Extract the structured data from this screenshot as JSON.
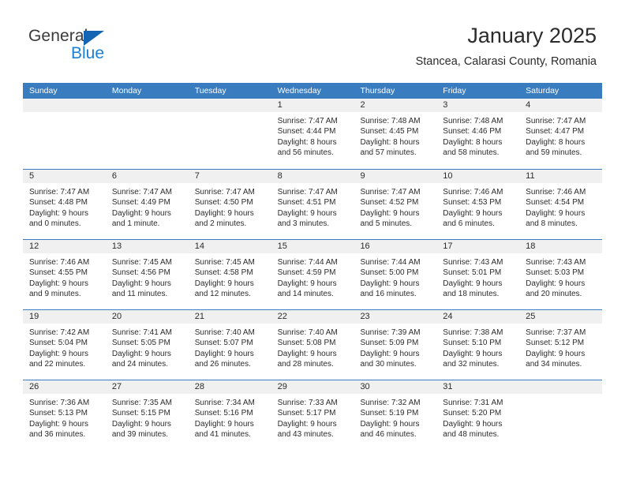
{
  "brand": {
    "name_part1": "General",
    "name_part2": "Blue",
    "accent_color": "#1b7fd4",
    "triangle_color": "#1565b5"
  },
  "header": {
    "title": "January 2025",
    "subtitle": "Stancea, Calarasi County, Romania"
  },
  "calendar": {
    "header_bg": "#3a7cc0",
    "daynum_bg": "#f0f0f0",
    "weekdays": [
      "Sunday",
      "Monday",
      "Tuesday",
      "Wednesday",
      "Thursday",
      "Friday",
      "Saturday"
    ],
    "weeks": [
      [
        {
          "day": "",
          "empty": true
        },
        {
          "day": "",
          "empty": true
        },
        {
          "day": "",
          "empty": true
        },
        {
          "day": "1",
          "sunrise": "Sunrise: 7:47 AM",
          "sunset": "Sunset: 4:44 PM",
          "daylight1": "Daylight: 8 hours",
          "daylight2": "and 56 minutes."
        },
        {
          "day": "2",
          "sunrise": "Sunrise: 7:48 AM",
          "sunset": "Sunset: 4:45 PM",
          "daylight1": "Daylight: 8 hours",
          "daylight2": "and 57 minutes."
        },
        {
          "day": "3",
          "sunrise": "Sunrise: 7:48 AM",
          "sunset": "Sunset: 4:46 PM",
          "daylight1": "Daylight: 8 hours",
          "daylight2": "and 58 minutes."
        },
        {
          "day": "4",
          "sunrise": "Sunrise: 7:47 AM",
          "sunset": "Sunset: 4:47 PM",
          "daylight1": "Daylight: 8 hours",
          "daylight2": "and 59 minutes."
        }
      ],
      [
        {
          "day": "5",
          "sunrise": "Sunrise: 7:47 AM",
          "sunset": "Sunset: 4:48 PM",
          "daylight1": "Daylight: 9 hours",
          "daylight2": "and 0 minutes."
        },
        {
          "day": "6",
          "sunrise": "Sunrise: 7:47 AM",
          "sunset": "Sunset: 4:49 PM",
          "daylight1": "Daylight: 9 hours",
          "daylight2": "and 1 minute."
        },
        {
          "day": "7",
          "sunrise": "Sunrise: 7:47 AM",
          "sunset": "Sunset: 4:50 PM",
          "daylight1": "Daylight: 9 hours",
          "daylight2": "and 2 minutes."
        },
        {
          "day": "8",
          "sunrise": "Sunrise: 7:47 AM",
          "sunset": "Sunset: 4:51 PM",
          "daylight1": "Daylight: 9 hours",
          "daylight2": "and 3 minutes."
        },
        {
          "day": "9",
          "sunrise": "Sunrise: 7:47 AM",
          "sunset": "Sunset: 4:52 PM",
          "daylight1": "Daylight: 9 hours",
          "daylight2": "and 5 minutes."
        },
        {
          "day": "10",
          "sunrise": "Sunrise: 7:46 AM",
          "sunset": "Sunset: 4:53 PM",
          "daylight1": "Daylight: 9 hours",
          "daylight2": "and 6 minutes."
        },
        {
          "day": "11",
          "sunrise": "Sunrise: 7:46 AM",
          "sunset": "Sunset: 4:54 PM",
          "daylight1": "Daylight: 9 hours",
          "daylight2": "and 8 minutes."
        }
      ],
      [
        {
          "day": "12",
          "sunrise": "Sunrise: 7:46 AM",
          "sunset": "Sunset: 4:55 PM",
          "daylight1": "Daylight: 9 hours",
          "daylight2": "and 9 minutes."
        },
        {
          "day": "13",
          "sunrise": "Sunrise: 7:45 AM",
          "sunset": "Sunset: 4:56 PM",
          "daylight1": "Daylight: 9 hours",
          "daylight2": "and 11 minutes."
        },
        {
          "day": "14",
          "sunrise": "Sunrise: 7:45 AM",
          "sunset": "Sunset: 4:58 PM",
          "daylight1": "Daylight: 9 hours",
          "daylight2": "and 12 minutes."
        },
        {
          "day": "15",
          "sunrise": "Sunrise: 7:44 AM",
          "sunset": "Sunset: 4:59 PM",
          "daylight1": "Daylight: 9 hours",
          "daylight2": "and 14 minutes."
        },
        {
          "day": "16",
          "sunrise": "Sunrise: 7:44 AM",
          "sunset": "Sunset: 5:00 PM",
          "daylight1": "Daylight: 9 hours",
          "daylight2": "and 16 minutes."
        },
        {
          "day": "17",
          "sunrise": "Sunrise: 7:43 AM",
          "sunset": "Sunset: 5:01 PM",
          "daylight1": "Daylight: 9 hours",
          "daylight2": "and 18 minutes."
        },
        {
          "day": "18",
          "sunrise": "Sunrise: 7:43 AM",
          "sunset": "Sunset: 5:03 PM",
          "daylight1": "Daylight: 9 hours",
          "daylight2": "and 20 minutes."
        }
      ],
      [
        {
          "day": "19",
          "sunrise": "Sunrise: 7:42 AM",
          "sunset": "Sunset: 5:04 PM",
          "daylight1": "Daylight: 9 hours",
          "daylight2": "and 22 minutes."
        },
        {
          "day": "20",
          "sunrise": "Sunrise: 7:41 AM",
          "sunset": "Sunset: 5:05 PM",
          "daylight1": "Daylight: 9 hours",
          "daylight2": "and 24 minutes."
        },
        {
          "day": "21",
          "sunrise": "Sunrise: 7:40 AM",
          "sunset": "Sunset: 5:07 PM",
          "daylight1": "Daylight: 9 hours",
          "daylight2": "and 26 minutes."
        },
        {
          "day": "22",
          "sunrise": "Sunrise: 7:40 AM",
          "sunset": "Sunset: 5:08 PM",
          "daylight1": "Daylight: 9 hours",
          "daylight2": "and 28 minutes."
        },
        {
          "day": "23",
          "sunrise": "Sunrise: 7:39 AM",
          "sunset": "Sunset: 5:09 PM",
          "daylight1": "Daylight: 9 hours",
          "daylight2": "and 30 minutes."
        },
        {
          "day": "24",
          "sunrise": "Sunrise: 7:38 AM",
          "sunset": "Sunset: 5:10 PM",
          "daylight1": "Daylight: 9 hours",
          "daylight2": "and 32 minutes."
        },
        {
          "day": "25",
          "sunrise": "Sunrise: 7:37 AM",
          "sunset": "Sunset: 5:12 PM",
          "daylight1": "Daylight: 9 hours",
          "daylight2": "and 34 minutes."
        }
      ],
      [
        {
          "day": "26",
          "sunrise": "Sunrise: 7:36 AM",
          "sunset": "Sunset: 5:13 PM",
          "daylight1": "Daylight: 9 hours",
          "daylight2": "and 36 minutes."
        },
        {
          "day": "27",
          "sunrise": "Sunrise: 7:35 AM",
          "sunset": "Sunset: 5:15 PM",
          "daylight1": "Daylight: 9 hours",
          "daylight2": "and 39 minutes."
        },
        {
          "day": "28",
          "sunrise": "Sunrise: 7:34 AM",
          "sunset": "Sunset: 5:16 PM",
          "daylight1": "Daylight: 9 hours",
          "daylight2": "and 41 minutes."
        },
        {
          "day": "29",
          "sunrise": "Sunrise: 7:33 AM",
          "sunset": "Sunset: 5:17 PM",
          "daylight1": "Daylight: 9 hours",
          "daylight2": "and 43 minutes."
        },
        {
          "day": "30",
          "sunrise": "Sunrise: 7:32 AM",
          "sunset": "Sunset: 5:19 PM",
          "daylight1": "Daylight: 9 hours",
          "daylight2": "and 46 minutes."
        },
        {
          "day": "31",
          "sunrise": "Sunrise: 7:31 AM",
          "sunset": "Sunset: 5:20 PM",
          "daylight1": "Daylight: 9 hours",
          "daylight2": "and 48 minutes."
        },
        {
          "day": "",
          "empty": true
        }
      ]
    ]
  }
}
